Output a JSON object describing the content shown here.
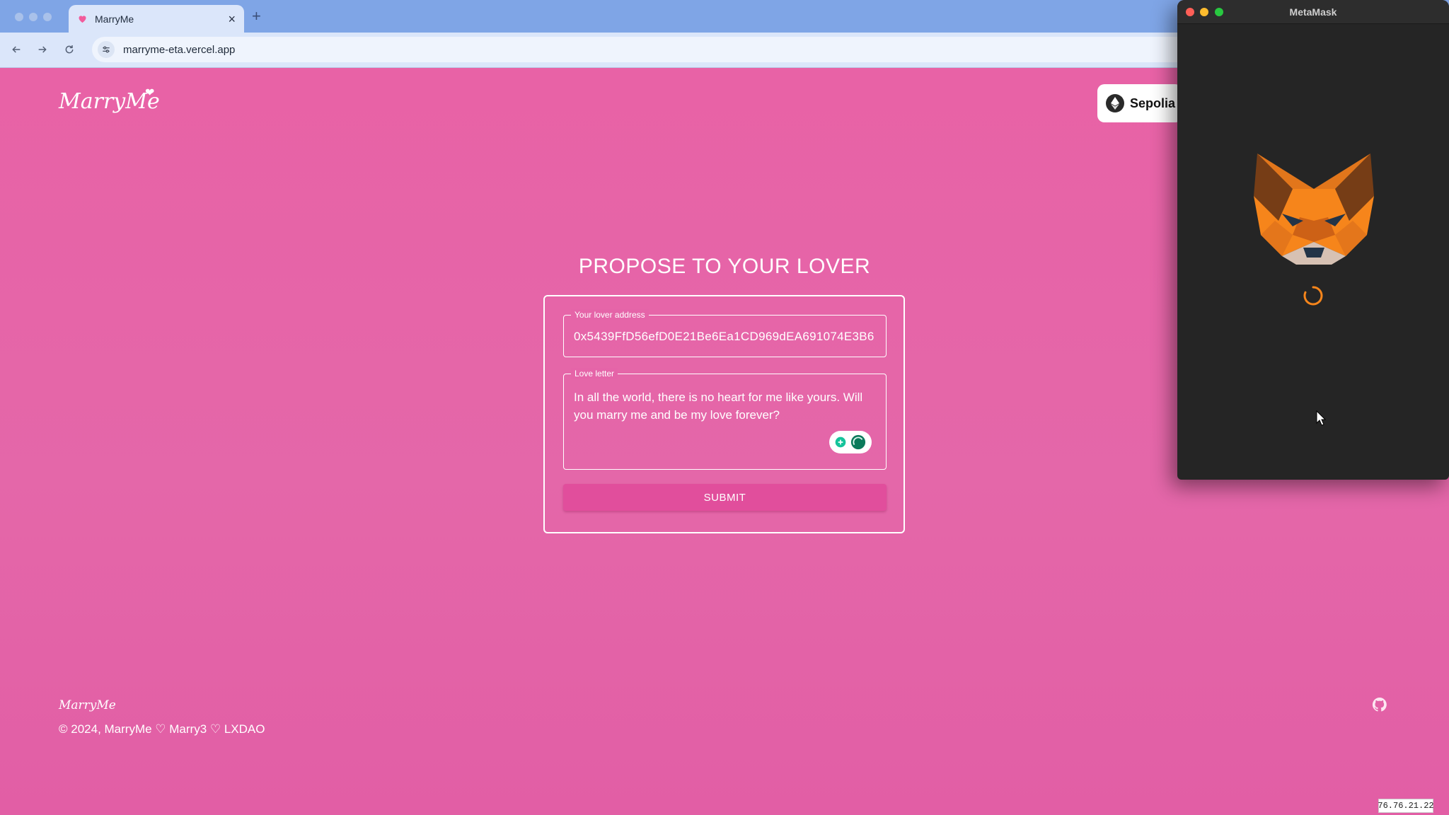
{
  "browser": {
    "tab": {
      "title": "MarryMe",
      "close_label": "×"
    },
    "new_tab_label": "+",
    "url": "marryme-eta.vercel.app"
  },
  "page": {
    "logo": "MarryMe",
    "network_label": "Sepolia",
    "heading": "PROPOSE TO YOUR LOVER",
    "form": {
      "address_label": "Your lover address",
      "address_value": "0x5439FfD56efD0E21Be6Ea1CD969dEA691074E3B6",
      "letter_label": "Love letter",
      "letter_value": "In all the world, there is no heart for me like yours. Will you marry me and be my love forever?",
      "submit_label": "SUBMIT"
    },
    "footer": {
      "logo": "MarryMe",
      "copyright": "© 2024, MarryMe ♡ Marry3 ♡ LXDAO"
    },
    "ip_badge": "76.76.21.22"
  },
  "metamask": {
    "title": "MetaMask"
  },
  "icons": {
    "back": "arrow-left-icon",
    "forward": "arrow-right-icon",
    "reload": "reload-icon",
    "site_settings": "tune-icon",
    "network": "ethereum-icon",
    "grammar": "grammarly-icon",
    "github": "github-icon",
    "fox": "metamask-fox-icon",
    "spinner": "loading-spinner-icon"
  },
  "colors": {
    "page_pink": "#e25fa4",
    "submit_pink": "#e14e9c",
    "chrome_blue": "#7fa5e6",
    "metamask_orange": "#f6851b",
    "metamask_bg": "#252525"
  }
}
